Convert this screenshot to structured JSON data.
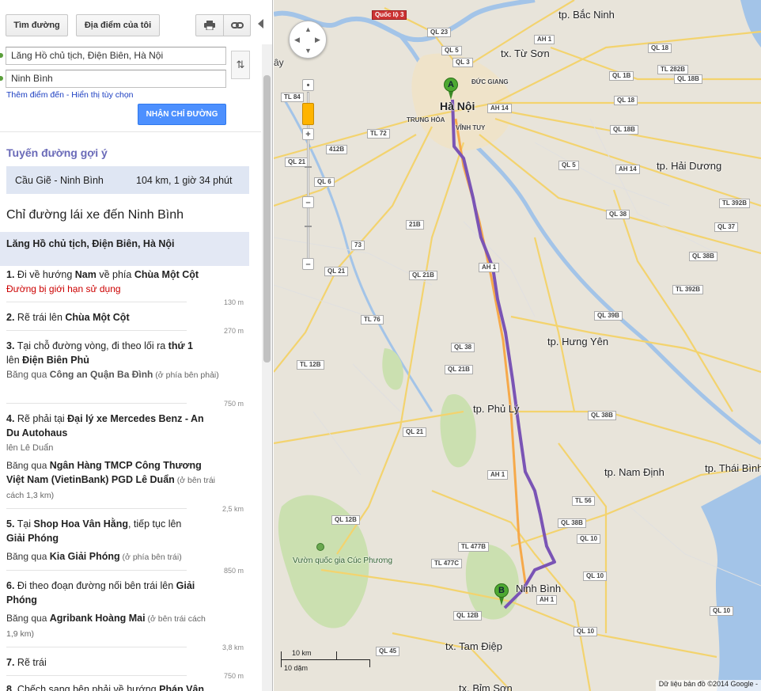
{
  "toolbar": {
    "directions_label": "Tìm đường",
    "myplaces_label": "Địa điểm của tôi",
    "print_icon": "print-icon",
    "link_icon": "link-icon"
  },
  "form": {
    "origin_value": "Lăng Hồ chủ tịch, Điện Biên, Hà Nội",
    "destination_value": "Ninh Bình",
    "add_destination": "Thêm điểm đến",
    "separator": " - ",
    "show_options": "Hiển thị tùy chọn",
    "get_directions": "NHẬN CHỈ ĐƯỜNG"
  },
  "route": {
    "heading": "Tuyến đường gợi ý",
    "name": "Cầu Giẽ - Ninh Bình",
    "stats": "104 km, 1 giờ 34 phút"
  },
  "directions": {
    "title": "Chỉ đường lái xe đến Ninh Bình",
    "start": "Lăng Hồ chủ tịch, Điện Biên, Hà Nội",
    "steps": [
      {
        "num": "1.",
        "a": "Đi về hướng ",
        "b": "Nam",
        "c": " về phía ",
        "d": "Chùa Một Cột",
        "warn": "Đường bị giới hạn sử dụng",
        "dist": "130 m"
      },
      {
        "num": "2.",
        "a": "Rẽ trái lên ",
        "b": "Chùa Một Cột",
        "dist": "270 m"
      },
      {
        "num": "3.",
        "a": "Tại chỗ đường vòng, đi theo lối ra ",
        "b": "thứ 1",
        "c": "lên ",
        "d": "Điện Biên Phủ",
        "pass": "Băng qua ",
        "pass_b": "Công an Quận Ba Đình",
        "pass_note": " (ở phía bên phải)",
        "dist": "750 m"
      },
      {
        "num": "4.",
        "a": "Rẽ phải tại ",
        "b": "Đại lý xe Mercedes Benz - An Du Autohaus",
        "onto": "lên Lê Duẩn",
        "pass": "Băng qua ",
        "pass_b": "Ngân Hàng TMCP Công Thương Việt Nam (VietinBank) PGD Lê Duẩn",
        "pass_note": " (ở bên trái cách 1,3 km)",
        "dist": "2,5 km"
      },
      {
        "num": "5.",
        "a": "Tại ",
        "b": "Shop Hoa Vân Hằng",
        "c": ", tiếp tục lên ",
        "d": "Giải Phóng",
        "pass": "Băng qua ",
        "pass_b": "Kia Giải Phóng",
        "pass_note": " (ở phía bên trái)",
        "dist": "850 m"
      },
      {
        "num": "6.",
        "a": "Đi theo đoạn đường nối bên trái lên ",
        "b": "Giải Phóng",
        "pass": "Băng qua ",
        "pass_b": "Agribank Hoàng Mai",
        "pass_note": " (ở bên trái cách 1,9 km)",
        "dist": "3,8 km"
      },
      {
        "num": "7.",
        "a": "Rẽ trái",
        "dist": "750 m"
      },
      {
        "num": "8.",
        "a": "Chếch sang bên phải về hướng ",
        "b": "Pháp Vân"
      }
    ]
  },
  "map": {
    "labels": {
      "bac_ninh": "tp. Bắc Ninh",
      "tu_son": "tx. Từ Sơn",
      "ha_noi": "Hà Nội",
      "duc_giang": "ĐỨC GIANG",
      "trung_hoa": "TRUNG HÒA",
      "vinh_tuy": "VĨNH TUY",
      "hai_duong": "tp. Hải Dương",
      "hung_yen": "tp. Hưng Yên",
      "phu_ly": "tp. Phủ Lý",
      "nam_dinh": "tp. Nam Định",
      "thai_binh": "tp. Thái Bình",
      "ninh_binh": "Ninh Bình",
      "tam_diep": "tx. Tam Điệp",
      "bim_son": "tx. Bỉm Sơn",
      "cuc_phuong": "Vườn quốc gia Cúc Phương",
      "ay": "ây"
    },
    "shields": [
      "Quốc lộ 3",
      "QL 23",
      "QL 5",
      "QL 3",
      "AH 1",
      "QL 18",
      "QL 1B",
      "TL 282B",
      "QL 18B",
      "TL 84",
      "AH 14",
      "QL 18",
      "QL 18B",
      "TL 72",
      "QL 5",
      "AH 14",
      "412B",
      "QL 6",
      "QL 21",
      "TL 392B",
      "QL 38",
      "21B",
      "73",
      "QL 21B",
      "AH 1",
      "QL 37",
      "QL 38B",
      "QL 21",
      "TL 392B",
      "TL 76",
      "QL 39B",
      "QL 38",
      "TL 12B",
      "QL 21B",
      "QL 38B",
      "QL 21",
      "AH 1",
      "TL 56",
      "QL 12B",
      "QL 38B",
      "TL 477B",
      "QL 10",
      "TL 477C",
      "AH 1",
      "QL 12B",
      "QL 10",
      "QL 10",
      "QL 45",
      "QL 10"
    ],
    "marker_a": "A",
    "marker_b": "B",
    "scale_km": "10 km",
    "scale_mi": "10 dặm",
    "copyright": "Dữ liệu bản đồ ©2014 Google -",
    "route_color": "#7a54b5"
  }
}
